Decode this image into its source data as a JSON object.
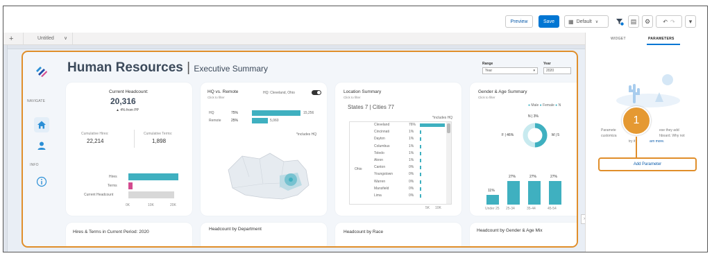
{
  "toolbar": {
    "preview": "Preview",
    "save": "Save",
    "default": "Default",
    "default_chevron": "∨"
  },
  "tabs": {
    "plus": "+",
    "untitled": "Untitled",
    "chevron": "∨"
  },
  "right_panel": {
    "tab_widget": "WIDGET",
    "tab_parameters": "PARAMETERS",
    "callout_number": "1",
    "help_line1_left": "Paramete",
    "help_line1_right": "ese they add",
    "help_line2_left": "customiza",
    "help_line2_right": "hboard. Why not",
    "help_line3_left": "try it?",
    "help_line3_link": "arn more.",
    "add_parameter": "Add Parameter"
  },
  "dashboard": {
    "title": "Human Resources",
    "separator": "|",
    "subtitle": "Executive Summary",
    "range_label": "Range",
    "range_value": "Year",
    "year_label": "Year",
    "year_value": "2020",
    "nav_navigate": "NAVIGATE",
    "nav_info": "INFO"
  },
  "headcount": {
    "label": "Current Headcount:",
    "value": "20,316",
    "change": "▲ 4% from PP",
    "hires_label": "Cumulative Hires:",
    "hires_value": "22,214",
    "terms_label": "Cumulative Terms:",
    "terms_value": "1,898",
    "bar_labels": [
      "Hires",
      "Terms",
      "Current Headcount"
    ],
    "axis_ticks": [
      "0K",
      "10K",
      "20K"
    ]
  },
  "hq_remote": {
    "title": "HQ vs. Remote",
    "subtitle": "Click to filter",
    "toggle_label": "HQ: Cleveland, Ohio",
    "rows": [
      {
        "label": "HQ",
        "pct": "75%",
        "value": "15,256"
      },
      {
        "label": "Remote",
        "pct": "25%",
        "value": "5,060"
      }
    ],
    "note": "*includes HQ"
  },
  "location": {
    "title": "Location Summary",
    "subtitle": "Click to filter",
    "counts": "States 7 | Cities 77",
    "note": "*includes HQ",
    "state": "Ohio",
    "cities": [
      {
        "name": "Cleveland",
        "pct": "76%"
      },
      {
        "name": "Cincinnati",
        "pct": "1%"
      },
      {
        "name": "Dayton",
        "pct": "1%"
      },
      {
        "name": "Columbus",
        "pct": "1%"
      },
      {
        "name": "Toledo",
        "pct": "1%"
      },
      {
        "name": "Akron",
        "pct": "1%"
      },
      {
        "name": "Canton",
        "pct": "0%"
      },
      {
        "name": "Youngstown",
        "pct": "0%"
      },
      {
        "name": "Warren",
        "pct": "0%"
      },
      {
        "name": "Mansfield",
        "pct": "0%"
      },
      {
        "name": "Lima",
        "pct": "0%"
      }
    ],
    "axis_ticks": [
      "5K",
      "10K"
    ]
  },
  "gender_age": {
    "title": "Gender & Age Summary",
    "subtitle": "Click to filter",
    "legend": [
      "Male",
      "Female",
      "N"
    ],
    "n_label": "N | 3%",
    "f_label": "F | 46%",
    "m_label": "M | 5",
    "bars": [
      {
        "label": "Under 25",
        "pct": "11%"
      },
      {
        "label": "25-34",
        "pct": "27%"
      },
      {
        "label": "35-44",
        "pct": "27%"
      },
      {
        "label": "45-54",
        "pct": "27%"
      }
    ]
  },
  "bottom_cards": [
    "Hires & Terms in Current Period: 2020",
    "Headcount by Department",
    "Headcount by Race",
    "Headcount by Gender & Age Mix"
  ],
  "colors": {
    "accent_teal": "#3fb0c0",
    "terms_pink": "#d34b8f",
    "highlight_orange": "#e08e2a",
    "save_blue": "#0176d3"
  }
}
